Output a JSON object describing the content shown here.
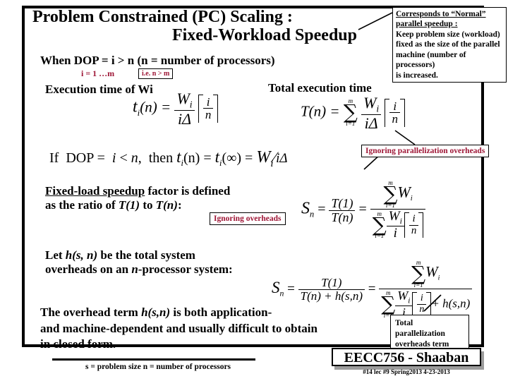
{
  "slide": {
    "title_line1": "Problem Constrained (PC) Scaling :",
    "title_line2": "Fixed-Workload Speedup",
    "dop_line": "When  DOP = i > n   (n = number of processors)",
    "dop_range": "i = 1 …m",
    "dop_note_box": "i.e. n > m",
    "exec_time_label": "Execution time of Wi",
    "total_exec_label": "Total execution time",
    "if_dop_line": "If  DOP =  i < n,  then",
    "fixed_load_heading": "Fixed-load speedup",
    "fixed_load_rest": " factor is defined",
    "fixed_load_line2_a": "as the ratio of ",
    "fixed_load_line2_b": "T(1)",
    "fixed_load_line2_c": " to ",
    "fixed_load_line2_d": "T(n)",
    "fixed_load_line2_e": ":",
    "let_h_line1_a": "Let  ",
    "let_h_line1_b": "h(s, n)",
    "let_h_line1_c": "  be the total system",
    "let_h_line2_a": "overheads on an ",
    "let_h_line2_b": "n",
    "let_h_line2_c": "-processor system:",
    "overhead_line1_a": "The overhead term ",
    "overhead_line1_b": "h(s,n)",
    "overhead_line1_c": "  is both application-",
    "overhead_line2": "and machine-dependent and usually difficult to obtain",
    "overhead_line3": "in closed form.",
    "bottom_note": "s = problem size   n = number of processors"
  },
  "callouts": {
    "normal_speedup_title_1": "Corresponds to “Normal”",
    "normal_speedup_title_2": "parallel speedup :",
    "normal_speedup_body_1": "Keep problem size (workload)",
    "normal_speedup_body_2": "fixed as the size of the parallel",
    "normal_speedup_body_3": "machine (number of processors)",
    "normal_speedup_body_4": "is increased.",
    "ignoring_parallelization": "Ignoring parallelization overheads",
    "ignoring_overheads": "Ignoring overheads",
    "total_overheads_line1": "Total parallelization",
    "total_overheads_line2": "overheads term"
  },
  "formulas": {
    "t_i_lhs": "t",
    "t_i_sub": "i",
    "t_i_arg": "(n) =",
    "W_i": "W",
    "i_delta": "iΔ",
    "ceil_num": "i",
    "ceil_den": "n",
    "T_lhs": "T(n) =",
    "sum_upper": "m",
    "sum_lower": "i=1",
    "if_then_t": "t",
    "if_then_tn": "(n) =",
    "if_then_tinf": "(∞) =",
    "if_then_rhs_num": "W",
    "if_then_rhs_den": "iΔ",
    "S_n": "S",
    "S_n_sub": "n",
    "S_eq": "=",
    "T1": "T(1)",
    "Tn": "T(n)",
    "Tn_plus_h": "T(n) + h(s,n)",
    "W_den_i": "i",
    "plus_h": "+ h(s,n)"
  },
  "footer": {
    "course": "EECC756 - Shaaban",
    "meta": "#14  lec #9   Spring2013  4-23-2013"
  },
  "colors": {
    "accent_red": "#9e1636",
    "text": "#000000",
    "background": "#ffffff",
    "shadow": "#9c9c9c"
  }
}
